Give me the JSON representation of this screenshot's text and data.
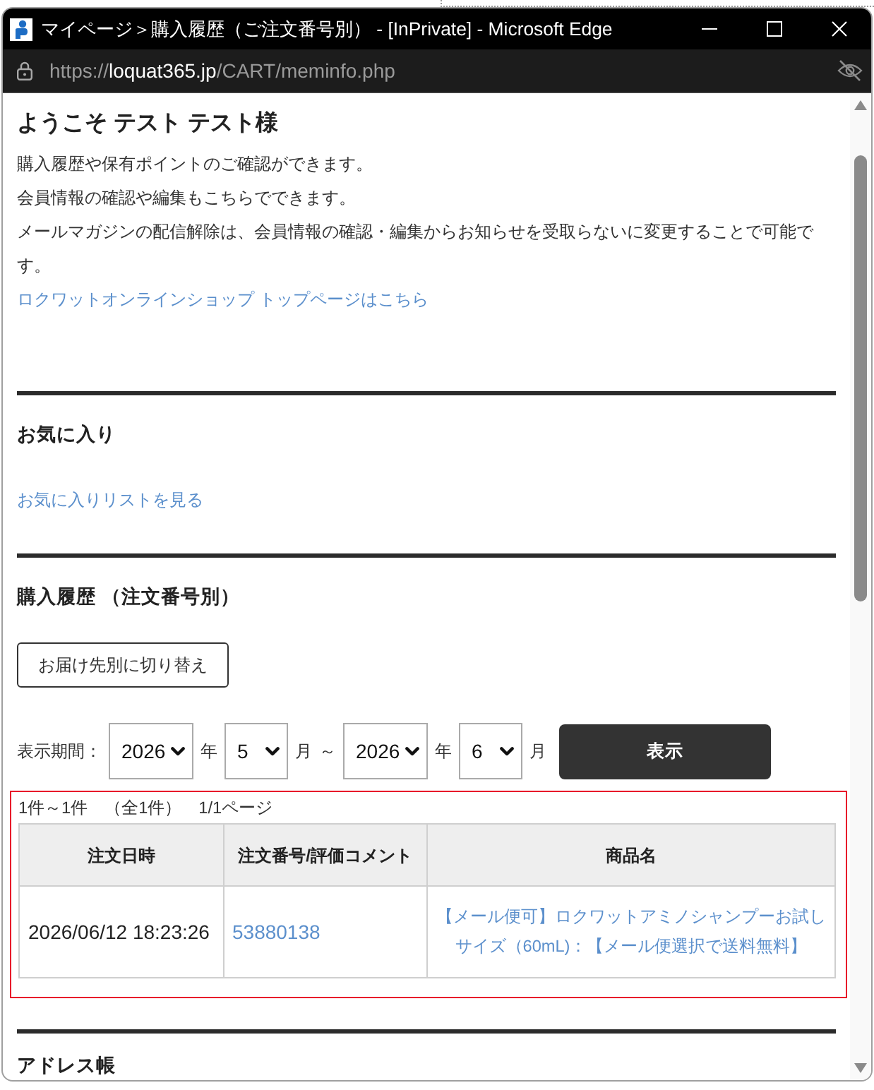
{
  "window": {
    "title": "マイページ＞購入履歴（ご注文番号別） - [InPrivate] - Microsoft Edge"
  },
  "address_bar": {
    "scheme": "https://",
    "domain": "loquat365.jp",
    "path": "/CART/meminfo.php"
  },
  "welcome": {
    "heading": "ようこそ テスト テスト様",
    "lines": [
      "購入履歴や保有ポイントのご確認ができます。",
      "会員情報の確認や編集もこちらでできます。",
      "メールマガジンの配信解除は、会員情報の確認・編集からお知らせを受取らないに変更することで可能です。"
    ],
    "link": "ロクワットオンラインショップ トップページはこちら"
  },
  "favorites": {
    "heading": "お気に入り",
    "link": "お気に入りリストを見る"
  },
  "purchase_history": {
    "heading": "購入履歴 （注文番号別）",
    "switch_button": "お届け先別に切り替え",
    "period": {
      "label": "表示期間：",
      "from": [
        {
          "value": "2026",
          "unit": "年"
        },
        {
          "value": "5",
          "unit": "月"
        }
      ],
      "separator": "～",
      "to": [
        {
          "value": "2026",
          "unit": "年"
        },
        {
          "value": "6",
          "unit": "月"
        }
      ],
      "button": "表示"
    },
    "results": {
      "summary": "1件～1件　（全1件）　1/1ページ",
      "columns": [
        "注文日時",
        "注文番号/評価コメント",
        "商品名"
      ],
      "rows": [
        {
          "date": "2026/06/12 18:23:26",
          "order_number": "53880138",
          "product": "【メール便可】ロクワットアミノシャンプーお試しサイズ（60mL)：【メール便選択で送料無料】"
        }
      ]
    }
  },
  "address_book": {
    "heading": "アドレス帳"
  }
}
